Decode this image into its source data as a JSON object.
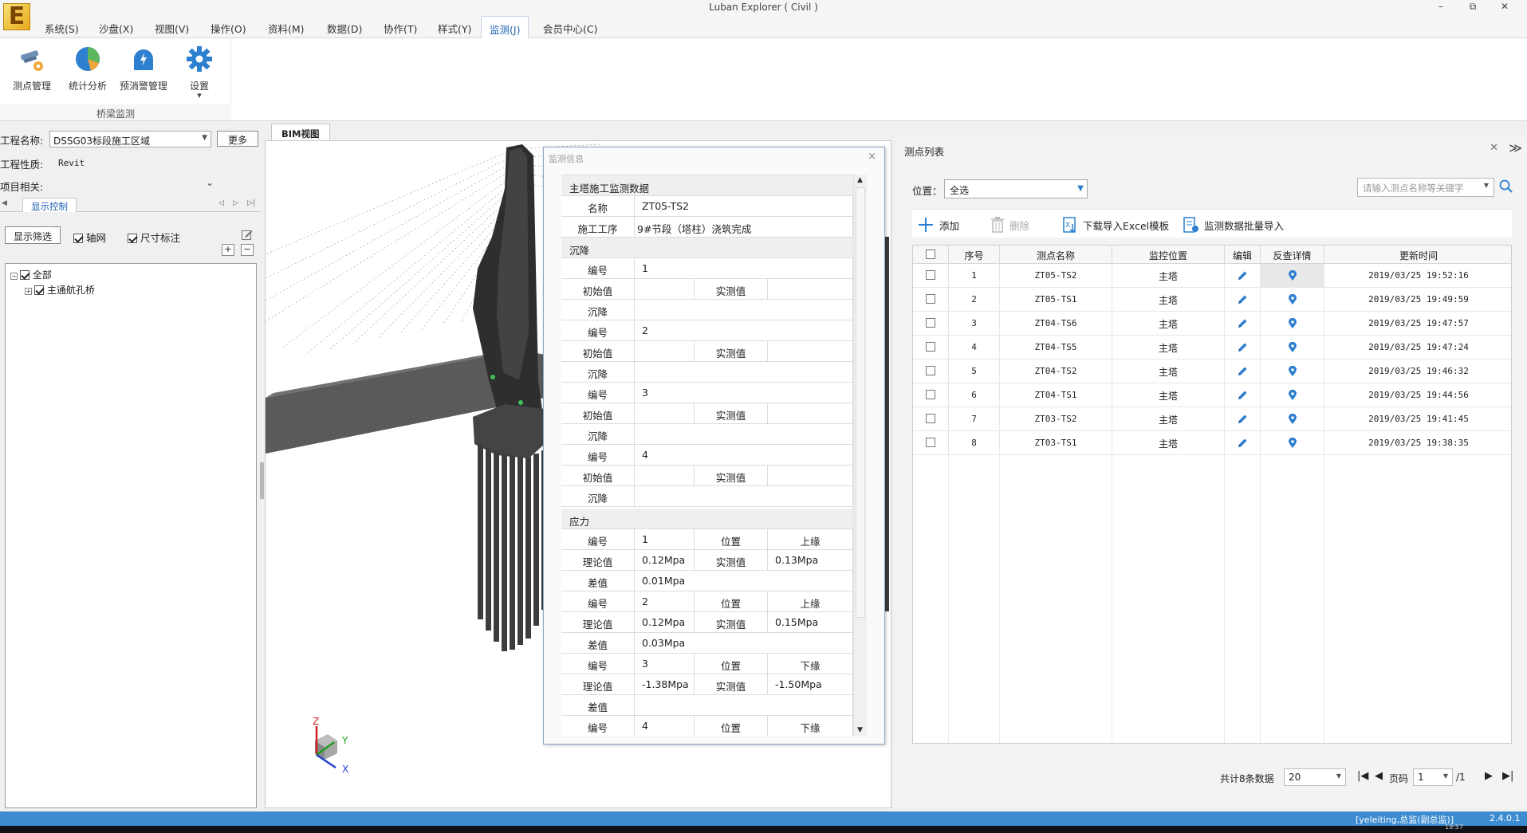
{
  "window": {
    "title": "Luban Explorer ( Civil )",
    "logo_letter": "E",
    "minimize": "–",
    "restore": "⧉",
    "close": "✕"
  },
  "menu": {
    "items": [
      "系统(S)",
      "沙盘(X)",
      "视图(V)",
      "操作(O)",
      "资料(M)",
      "数据(D)",
      "协作(T)",
      "样式(Y)",
      "监测(J)",
      "会员中心(C)"
    ],
    "active_index": 8
  },
  "ribbon": {
    "buttons": [
      "测点管理",
      "统计分析",
      "预消警管理",
      "设置"
    ],
    "group_label": "桥梁监测"
  },
  "left": {
    "project_label": "工程名称:",
    "project_value": "DSSG03标段施工区域",
    "more_button": "更多",
    "nature_label": "工程性质:",
    "nature_value": "Revit",
    "related_label": "项目相关:",
    "tab_label": "显示控制",
    "filter_button": "显示筛选",
    "axis_checkbox": "轴网",
    "dimension_checkbox": "尺寸标注",
    "tree_root": "全部",
    "tree_child": "主通航孔桥"
  },
  "bim": {
    "tab_label": "BIM视图",
    "axis_z": "Z",
    "axis_y": "Y",
    "axis_x": "X"
  },
  "dialog": {
    "title": "监测信息",
    "close": "×",
    "header": "主塔施工监测数据",
    "name_label": "名称",
    "name_value": "ZT05-TS2",
    "process_label": "施工工序",
    "process_value": "9#节段（塔柱）浇筑完成",
    "settlement_title": "沉降",
    "settlement": [
      {
        "no_label": "编号",
        "no": "1",
        "init_label": "初始值",
        "init": "",
        "meas_label": "实测值",
        "meas": "",
        "settle_label": "沉降",
        "settle": ""
      },
      {
        "no_label": "编号",
        "no": "2",
        "init_label": "初始值",
        "init": "",
        "meas_label": "实测值",
        "meas": "",
        "settle_label": "沉降",
        "settle": ""
      },
      {
        "no_label": "编号",
        "no": "3",
        "init_label": "初始值",
        "init": "",
        "meas_label": "实测值",
        "meas": "",
        "settle_label": "沉降",
        "settle": ""
      },
      {
        "no_label": "编号",
        "no": "4",
        "init_label": "初始值",
        "init": "",
        "meas_label": "实测值",
        "meas": "",
        "settle_label": "沉降",
        "settle": ""
      }
    ],
    "stress_title": "应力",
    "stress": [
      {
        "no_label": "编号",
        "no": "1",
        "pos_label": "位置",
        "pos": "上缘",
        "theo_label": "理论值",
        "theo": "0.12Mpa",
        "meas_label": "实测值",
        "meas": "0.13Mpa",
        "diff_label": "差值",
        "diff": "0.01Mpa"
      },
      {
        "no_label": "编号",
        "no": "2",
        "pos_label": "位置",
        "pos": "上缘",
        "theo_label": "理论值",
        "theo": "0.12Mpa",
        "meas_label": "实测值",
        "meas": "0.15Mpa",
        "diff_label": "差值",
        "diff": "0.03Mpa"
      },
      {
        "no_label": "编号",
        "no": "3",
        "pos_label": "位置",
        "pos": "下缘",
        "theo_label": "理论值",
        "theo": "-1.38Mpa",
        "meas_label": "实测值",
        "meas": "-1.50Mpa",
        "diff_label": "差值",
        "diff": ""
      },
      {
        "no_label": "编号",
        "no": "4",
        "pos_label": "位置",
        "pos": "下缘"
      }
    ]
  },
  "right": {
    "title": "测点列表",
    "close": "✕",
    "collapse": "≫",
    "position_label": "位置：",
    "position_value": "全选",
    "search_placeholder": "请输入测点名称等关键字",
    "toolbar": {
      "add": "添加",
      "delete": "删除",
      "download": "下载导入Excel模板",
      "import": "监测数据批量导入"
    },
    "columns": [
      "序号",
      "测点名称",
      "监控位置",
      "编辑",
      "反查详情",
      "更新时间"
    ],
    "rows": [
      {
        "no": "1",
        "name": "ZT05-TS2",
        "loc": "主塔",
        "time": "2019/03/25 19:52:16"
      },
      {
        "no": "2",
        "name": "ZT05-TS1",
        "loc": "主塔",
        "time": "2019/03/25 19:49:59"
      },
      {
        "no": "3",
        "name": "ZT04-TS6",
        "loc": "主塔",
        "time": "2019/03/25 19:47:57"
      },
      {
        "no": "4",
        "name": "ZT04-TS5",
        "loc": "主塔",
        "time": "2019/03/25 19:47:24"
      },
      {
        "no": "5",
        "name": "ZT04-TS2",
        "loc": "主塔",
        "time": "2019/03/25 19:46:32"
      },
      {
        "no": "6",
        "name": "ZT04-TS1",
        "loc": "主塔",
        "time": "2019/03/25 19:44:56"
      },
      {
        "no": "7",
        "name": "ZT03-TS2",
        "loc": "主塔",
        "time": "2019/03/25 19:41:45"
      },
      {
        "no": "8",
        "name": "ZT03-TS1",
        "loc": "主塔",
        "time": "2019/03/25 19:38:35"
      }
    ],
    "footer": {
      "total": "共计8条数据",
      "page_size": "20",
      "page_label": "页码",
      "page_value": "1",
      "page_total": "/1"
    }
  },
  "status": {
    "user": "[yeleiting,总监(副总监)]",
    "version": "2.4.0.1",
    "clock": "19:57"
  },
  "colors": {
    "accent": "#1f5fb0",
    "statusbar": "#3d8bd0",
    "icon_blue": "#2d7fcf",
    "structure_dark": "#3a3a3a"
  }
}
